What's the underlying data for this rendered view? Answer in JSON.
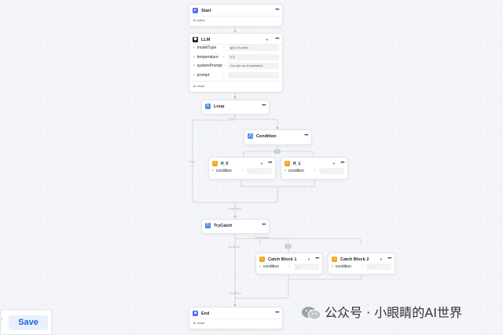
{
  "nodes": {
    "start": {
      "title": "Start",
      "output_label": "query"
    },
    "llm": {
      "title": "LLM",
      "params": [
        {
          "name": "modelType",
          "value": "gpt-3.5-turbo"
        },
        {
          "name": "temperature",
          "value": "0.5"
        },
        {
          "name": "systemPrompt",
          "value": "You are an AI assistant."
        },
        {
          "name": "prompt",
          "value": "..."
        }
      ],
      "output_label": "result"
    },
    "loop": {
      "title": "Loop"
    },
    "condition": {
      "title": "Condition"
    },
    "if0": {
      "title": "If_0",
      "param": "condition",
      "value": "..."
    },
    "if1": {
      "title": "If_1",
      "param": "condition",
      "value": "..."
    },
    "trycatch": {
      "title": "TryCatch"
    },
    "catch1": {
      "title": "Catch Block 1",
      "param": "condition",
      "value": "..."
    },
    "catch2": {
      "title": "Catch Block 2",
      "param": "condition",
      "value": "..."
    },
    "end": {
      "title": "End",
      "output_label": "result"
    }
  },
  "edge_labels": {
    "loop_body": "Loop",
    "loop_left": "Loop",
    "loop_after": "Loop finish",
    "try_branch": "Try Block",
    "catch_branch": "Catch Block",
    "try_end": "Try Block"
  },
  "toolbar": {
    "save_label": "Save"
  },
  "watermark": {
    "text": "公众号 · 小眼睛的AI世界"
  },
  "colors": {
    "accent": "#1a66d8",
    "start_icon": "#5b6ef5",
    "llm_icon": "#1f2329",
    "loop_icon": "#4a90e2",
    "condition_icon": "#4f8ff7",
    "branch_icon": "#f5a623",
    "trycatch_icon": "#4a7fe8",
    "end_icon": "#5b6ef5"
  }
}
